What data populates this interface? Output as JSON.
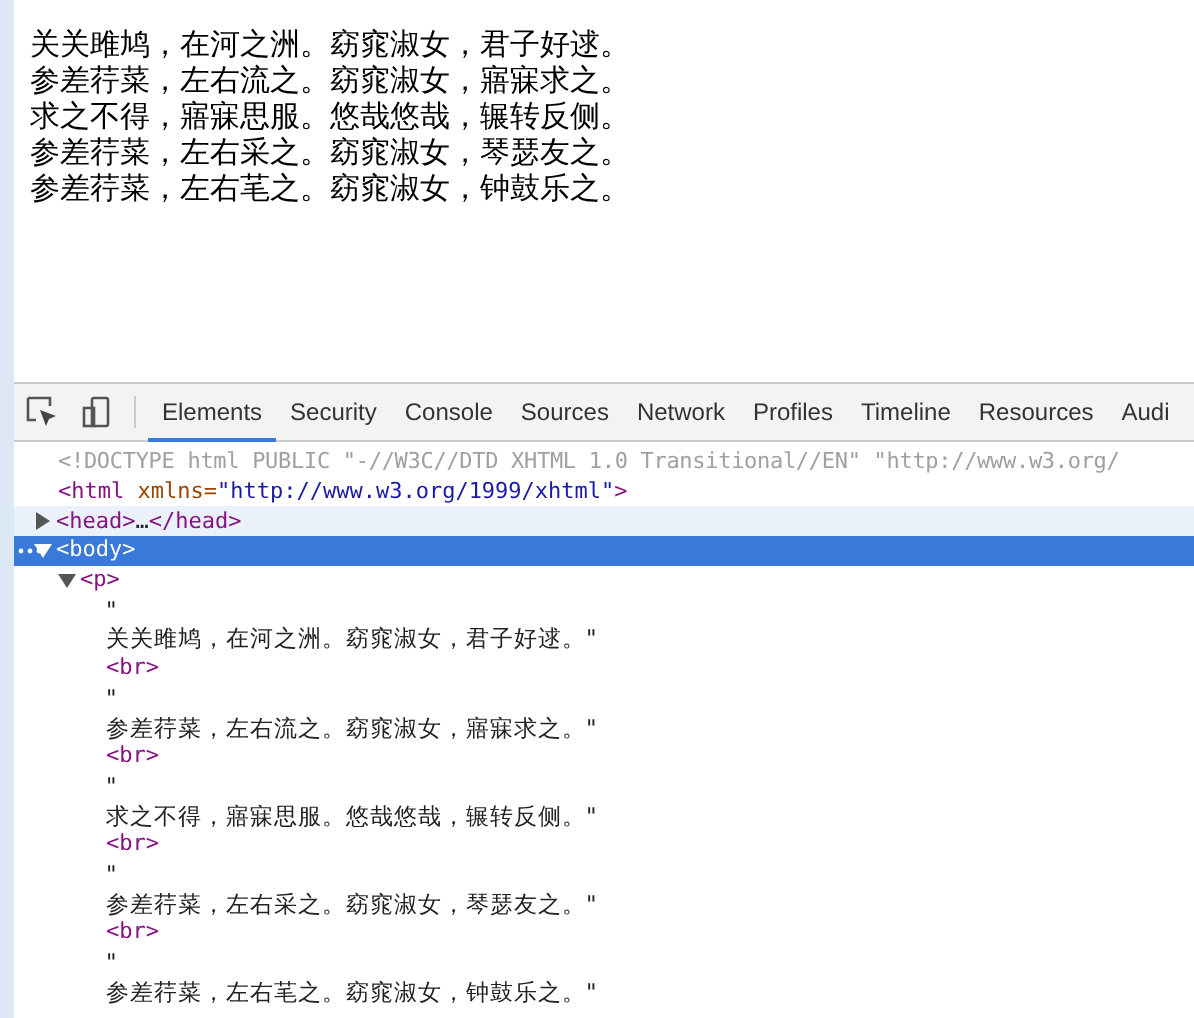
{
  "page": {
    "lines": [
      "关关雎鸠，在河之洲。窈窕淑女，君子好逑。",
      "参差荇菜，左右流之。窈窕淑女，寤寐求之。",
      "求之不得，寤寐思服。悠哉悠哉，辗转反侧。",
      "参差荇菜，左右采之。窈窕淑女，琴瑟友之。",
      "参差荇菜，左右芼之。窈窕淑女，钟鼓乐之。"
    ]
  },
  "devtools": {
    "tabs": [
      {
        "label": "Elements",
        "selected": true
      },
      {
        "label": "Security",
        "selected": false
      },
      {
        "label": "Console",
        "selected": false
      },
      {
        "label": "Sources",
        "selected": false
      },
      {
        "label": "Network",
        "selected": false
      },
      {
        "label": "Profiles",
        "selected": false
      },
      {
        "label": "Timeline",
        "selected": false
      },
      {
        "label": "Resources",
        "selected": false
      },
      {
        "label": "Audi",
        "selected": false
      }
    ],
    "dom": [
      {
        "kind": "doctype",
        "segments": [
          {
            "kind": "doctype",
            "text": "<!DOCTYPE html PUBLIC \"-//W3C//DTD XHTML 1.0 Transitional//EN\" \"http://www.w3.org/"
          }
        ]
      },
      {
        "kind": "element",
        "selected": false,
        "hovered": false,
        "segments": [
          {
            "kind": "tag",
            "text": "<html"
          },
          {
            "kind": "attr",
            "text": " xmlns="
          },
          {
            "kind": "value",
            "text": "\"http://www.w3.org/1999/xhtml\""
          },
          {
            "kind": "tag",
            "text": ">"
          }
        ],
        "children": [
          {
            "kind": "element",
            "expanded": false,
            "selected": false,
            "hovered": true,
            "segments": [
              {
                "kind": "tag",
                "text": "<head>"
              },
              {
                "kind": "plain",
                "text": "…"
              },
              {
                "kind": "tag",
                "text": "</head>"
              }
            ]
          },
          {
            "kind": "element",
            "expanded": true,
            "selected": true,
            "hovered": false,
            "segments": [
              {
                "kind": "tag",
                "text": "<body>"
              }
            ],
            "children": [
              {
                "kind": "element",
                "expanded": true,
                "selected": false,
                "hovered": false,
                "segments": [
                  {
                    "kind": "tag",
                    "text": "<p>"
                  }
                ],
                "children": [
                  {
                    "kind": "text",
                    "segments": [
                      {
                        "kind": "plain",
                        "text": "\""
                      }
                    ]
                  },
                  {
                    "kind": "text",
                    "segments": [
                      {
                        "kind": "plain",
                        "text": "关关雎鸠，在河之洲。窈窕淑女，君子好逑。\""
                      }
                    ]
                  },
                  {
                    "kind": "element",
                    "selected": false,
                    "hovered": false,
                    "segments": [
                      {
                        "kind": "tag",
                        "text": "<br>"
                      }
                    ]
                  },
                  {
                    "kind": "text",
                    "segments": [
                      {
                        "kind": "plain",
                        "text": "\""
                      }
                    ]
                  },
                  {
                    "kind": "text",
                    "segments": [
                      {
                        "kind": "plain",
                        "text": "参差荇菜，左右流之。窈窕淑女，寤寐求之。\""
                      }
                    ]
                  },
                  {
                    "kind": "element",
                    "selected": false,
                    "hovered": false,
                    "segments": [
                      {
                        "kind": "tag",
                        "text": "<br>"
                      }
                    ]
                  },
                  {
                    "kind": "text",
                    "segments": [
                      {
                        "kind": "plain",
                        "text": "\""
                      }
                    ]
                  },
                  {
                    "kind": "text",
                    "segments": [
                      {
                        "kind": "plain",
                        "text": "求之不得，寤寐思服。悠哉悠哉，辗转反侧。\""
                      }
                    ]
                  },
                  {
                    "kind": "element",
                    "selected": false,
                    "hovered": false,
                    "segments": [
                      {
                        "kind": "tag",
                        "text": "<br>"
                      }
                    ]
                  },
                  {
                    "kind": "text",
                    "segments": [
                      {
                        "kind": "plain",
                        "text": "\""
                      }
                    ]
                  },
                  {
                    "kind": "text",
                    "segments": [
                      {
                        "kind": "plain",
                        "text": "参差荇菜，左右采之。窈窕淑女，琴瑟友之。\""
                      }
                    ]
                  },
                  {
                    "kind": "element",
                    "selected": false,
                    "hovered": false,
                    "segments": [
                      {
                        "kind": "tag",
                        "text": "<br>"
                      }
                    ]
                  },
                  {
                    "kind": "text",
                    "segments": [
                      {
                        "kind": "plain",
                        "text": "\""
                      }
                    ]
                  },
                  {
                    "kind": "text",
                    "segments": [
                      {
                        "kind": "plain",
                        "text": "参差荇菜，左右芼之。窈窕淑女，钟鼓乐之。\""
                      }
                    ]
                  }
                ]
              }
            ]
          }
        ]
      }
    ]
  }
}
